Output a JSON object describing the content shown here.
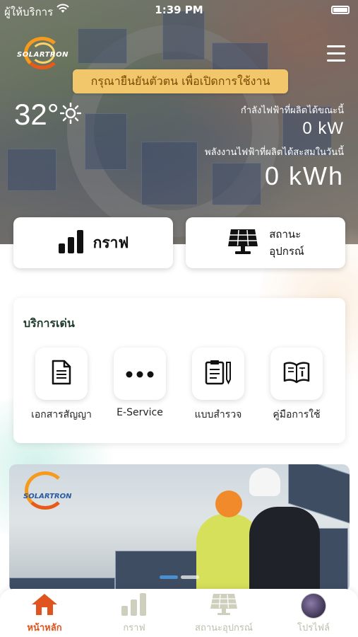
{
  "status_bar": {
    "carrier": "ผู้ให้บริการ",
    "time": "1:39 PM"
  },
  "header": {
    "logo_text": "SOLARTRON",
    "verify_banner": "กรุณายืนยันตัวตน เพื่อเปิดการใช้งาน"
  },
  "weather": {
    "temperature": "32°"
  },
  "power": {
    "current_label": "กำลังไฟฟ้าที่ผลิตได้ขณะนี้",
    "current_value": "0 kW",
    "accumulated_label": "พลังงานไฟฟ้าที่ผลิตได้สะสมในวันนี้",
    "accumulated_value": "0 kWh"
  },
  "quick_actions": {
    "graph_label": "กราฟ",
    "device_status_line1": "สถานะ",
    "device_status_line2": "อุปกรณ์"
  },
  "services": {
    "title": "บริการเด่น",
    "items": [
      {
        "label": "เอกสารสัญญา",
        "icon": "document-icon"
      },
      {
        "label": "E-Service",
        "icon": "more-dots-icon"
      },
      {
        "label": "แบบสำรวจ",
        "icon": "survey-icon"
      },
      {
        "label": "คู่มือการใช้",
        "icon": "manual-book-icon"
      }
    ]
  },
  "banner": {
    "logo_text": "SOLARTRON",
    "slide_count": 2,
    "active_slide": 1
  },
  "tabbar": {
    "items": [
      {
        "label": "หน้าหลัก",
        "icon": "home-icon",
        "active": true
      },
      {
        "label": "กราฟ",
        "icon": "bar-chart-icon",
        "active": false
      },
      {
        "label": "สถานะอุปกรณ์",
        "icon": "solar-panel-icon",
        "active": false
      },
      {
        "label": "โปรไฟล์",
        "icon": "avatar",
        "active": false
      }
    ]
  },
  "colors": {
    "accent": "#e0541f",
    "verify_bg": "#f2c66b",
    "title_green": "#1e3b2c"
  }
}
